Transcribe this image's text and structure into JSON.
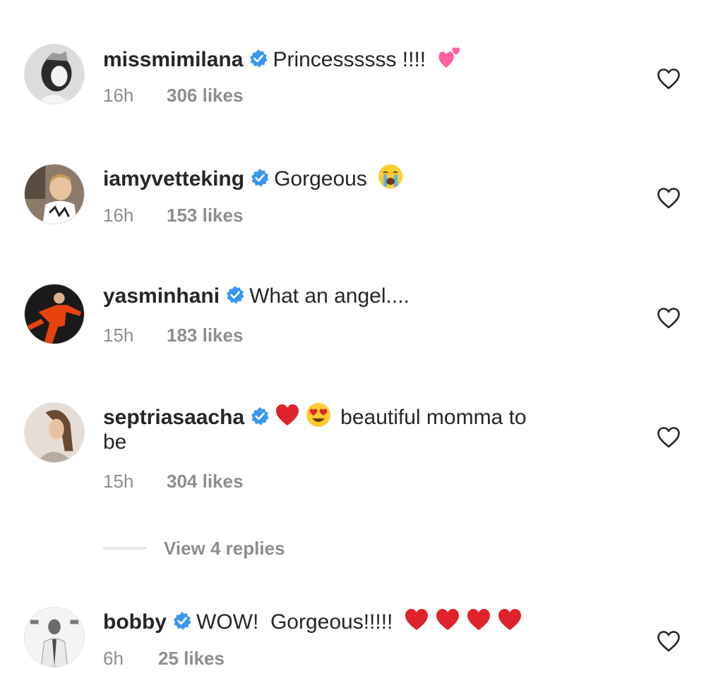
{
  "comments": [
    {
      "username": "missmimilana",
      "verified": true,
      "text": "Princessssss !!!!",
      "emoji": [
        "two-hearts"
      ],
      "time": "16h",
      "likes": "306 likes"
    },
    {
      "username": "iamyvetteking",
      "verified": true,
      "text": "Gorgeous",
      "emoji": [
        "crying-face"
      ],
      "time": "16h",
      "likes": "153 likes"
    },
    {
      "username": "yasminhani",
      "verified": true,
      "text": "What an angel....",
      "emoji": [],
      "time": "15h",
      "likes": "183 likes"
    },
    {
      "username": "septriasaacha",
      "verified": true,
      "text": "beautiful momma to",
      "text_line2": "be",
      "emoji": [
        "red-heart",
        "heart-eyes-face"
      ],
      "time": "15h",
      "likes": "304 likes",
      "view_replies": "View 4 replies"
    },
    {
      "username": "bobby",
      "verified": true,
      "text": "WOW!  Gorgeous!!!!!",
      "emoji": [
        "red-heart",
        "red-heart",
        "red-heart",
        "red-heart"
      ],
      "time": "6h",
      "likes": "25 likes"
    }
  ],
  "colors": {
    "username": "#262626",
    "meta": "#8e8e8e",
    "verified": "#3897f0",
    "heart_outline": "#262626",
    "red_heart": "#e0222b"
  }
}
